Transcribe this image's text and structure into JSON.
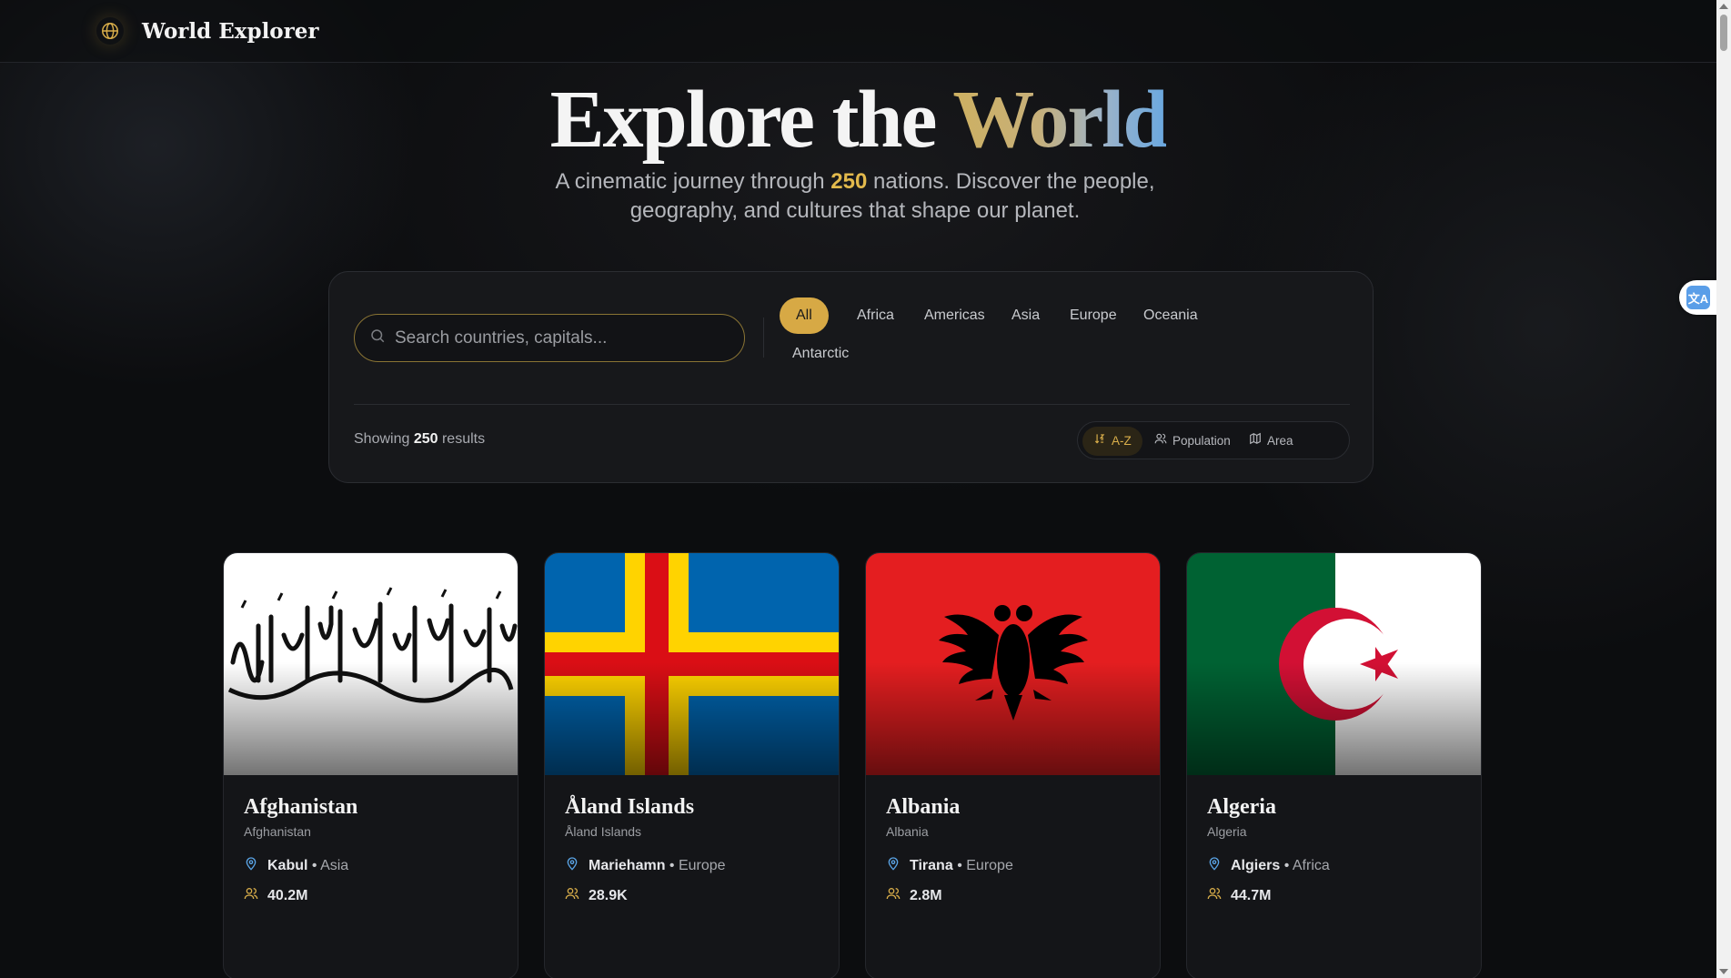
{
  "header": {
    "brand": "World Explorer",
    "icon": "globe-icon"
  },
  "hero": {
    "title_prefix": "Explore the ",
    "title_accent": "World",
    "sub_before": "A cinematic journey through ",
    "sub_count": "250",
    "sub_after": " nations. Discover the people, geography, and cultures that shape our planet."
  },
  "search": {
    "placeholder": "Search countries, capitals...",
    "value": ""
  },
  "filters": {
    "regions": [
      "All",
      "Africa",
      "Americas",
      "Asia",
      "Europe",
      "Oceania",
      "Antarctic"
    ],
    "active": "All"
  },
  "results": {
    "prefix": "Showing ",
    "count": "250",
    "suffix": " results"
  },
  "sort": {
    "options": [
      {
        "label": "A-Z",
        "icon": "sort-az-icon"
      },
      {
        "label": "Population",
        "icon": "users-icon"
      },
      {
        "label": "Area",
        "icon": "map-icon"
      }
    ],
    "active": "A-Z"
  },
  "countries": [
    {
      "name": "Afghanistan",
      "native": "Afghanistan",
      "capital": "Kabul",
      "region": "Asia",
      "population": "40.2M"
    },
    {
      "name": "Åland Islands",
      "native": "Åland Islands",
      "capital": "Mariehamn",
      "region": "Europe",
      "population": "28.9K"
    },
    {
      "name": "Albania",
      "native": "Albania",
      "capital": "Tirana",
      "region": "Europe",
      "population": "2.8M"
    },
    {
      "name": "Algeria",
      "native": "Algeria",
      "capital": "Algiers",
      "region": "Africa",
      "population": "44.7M"
    }
  ],
  "colors": {
    "accent": "#d7a945",
    "pin": "#5aa4e6",
    "people": "#d9ae4a"
  }
}
